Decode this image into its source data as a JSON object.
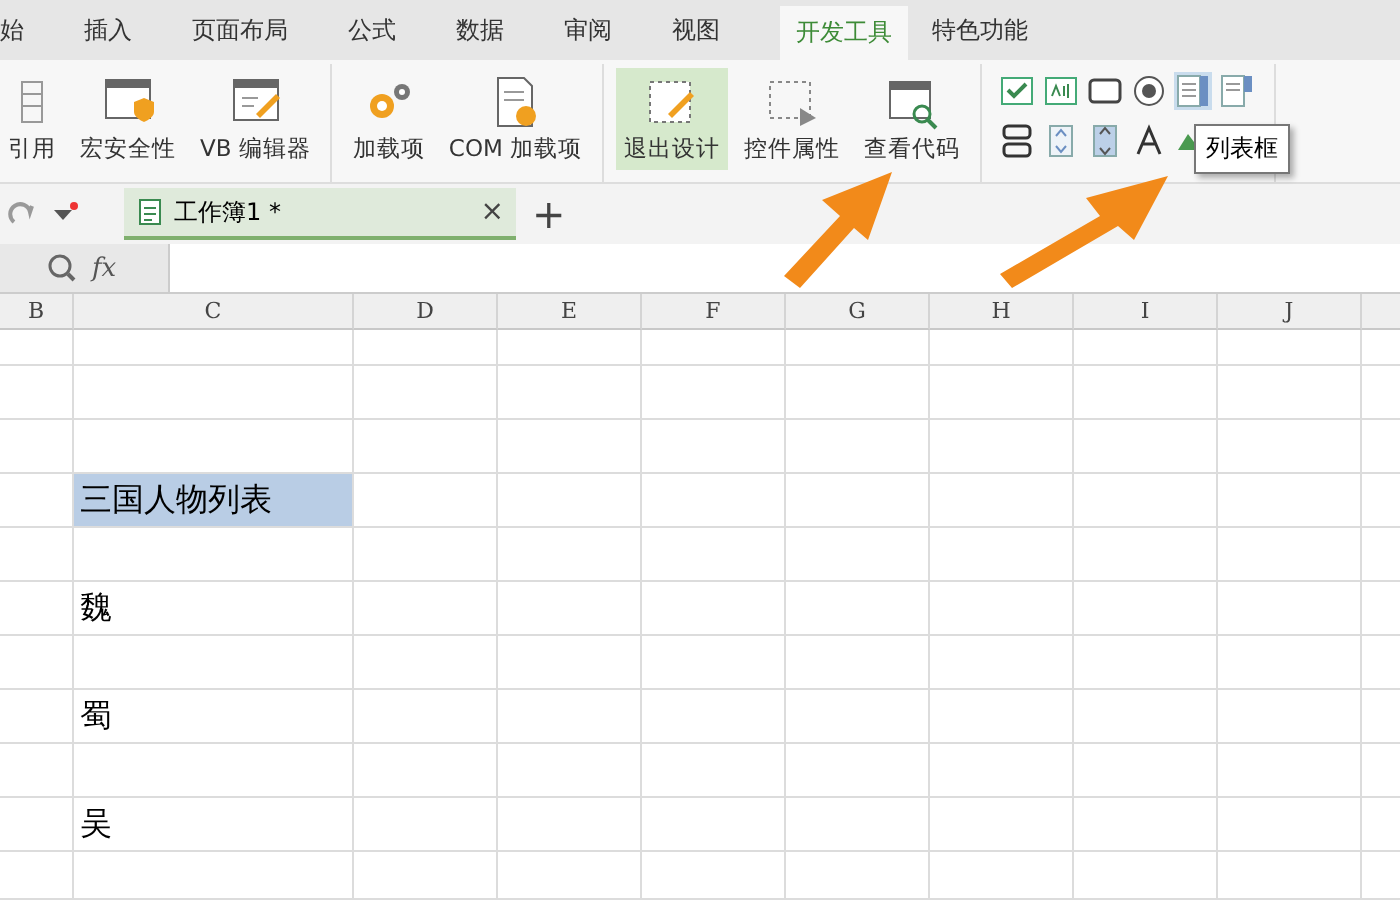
{
  "menu_tabs": [
    {
      "label": "始",
      "selected": false
    },
    {
      "label": "插入",
      "selected": false
    },
    {
      "label": "页面布局",
      "selected": false
    },
    {
      "label": "公式",
      "selected": false
    },
    {
      "label": "数据",
      "selected": false
    },
    {
      "label": "审阅",
      "selected": false
    },
    {
      "label": "视图",
      "selected": false
    },
    {
      "label": "开发工具",
      "selected": true
    },
    {
      "label": "特色功能",
      "selected": false
    }
  ],
  "ribbon": {
    "groups": [
      [
        {
          "label": "引用",
          "kind": "grid",
          "pressed": false
        },
        {
          "label": "宏安全性",
          "kind": "shield",
          "pressed": false
        },
        {
          "label": "VB 编辑器",
          "kind": "editor",
          "pressed": false
        }
      ],
      [
        {
          "label": "加载项",
          "kind": "gears",
          "pressed": false
        },
        {
          "label": "COM 加载项",
          "kind": "docgear",
          "pressed": false
        }
      ],
      [
        {
          "label": "退出设计",
          "kind": "design",
          "pressed": true
        },
        {
          "label": "控件属性",
          "kind": "props",
          "pressed": false
        },
        {
          "label": "查看代码",
          "kind": "code",
          "pressed": false
        }
      ]
    ],
    "controls": [
      {
        "kind": "checkbox",
        "selected": false
      },
      {
        "kind": "textbox",
        "selected": false
      },
      {
        "kind": "button",
        "selected": false
      },
      {
        "kind": "radio",
        "selected": false
      },
      {
        "kind": "listbox",
        "selected": true
      },
      {
        "kind": "combobox",
        "selected": false
      },
      {
        "kind": "toggle",
        "selected": false
      },
      {
        "kind": "spin",
        "selected": false
      },
      {
        "kind": "scroll",
        "selected": false
      },
      {
        "kind": "label",
        "selected": false
      },
      {
        "kind": "image",
        "selected": false
      }
    ],
    "tooltip": "列表框"
  },
  "doc_tab": {
    "title": "工作簿1 *",
    "close": "×",
    "add": "+"
  },
  "formula_bar": {
    "fx": "fx"
  },
  "columns": [
    "B",
    "C",
    "D",
    "E",
    "F",
    "G",
    "H",
    "I",
    "J"
  ],
  "rows": [
    {
      "cell": "",
      "selected": false
    },
    {
      "cell": "",
      "selected": false
    },
    {
      "cell": "",
      "selected": false
    },
    {
      "cell": "三国人物列表",
      "selected": true
    },
    {
      "cell": "",
      "selected": false
    },
    {
      "cell": "魏",
      "selected": false
    },
    {
      "cell": "",
      "selected": false
    },
    {
      "cell": "蜀",
      "selected": false
    },
    {
      "cell": "",
      "selected": false
    },
    {
      "cell": "吴",
      "selected": false
    },
    {
      "cell": "",
      "selected": false
    }
  ]
}
